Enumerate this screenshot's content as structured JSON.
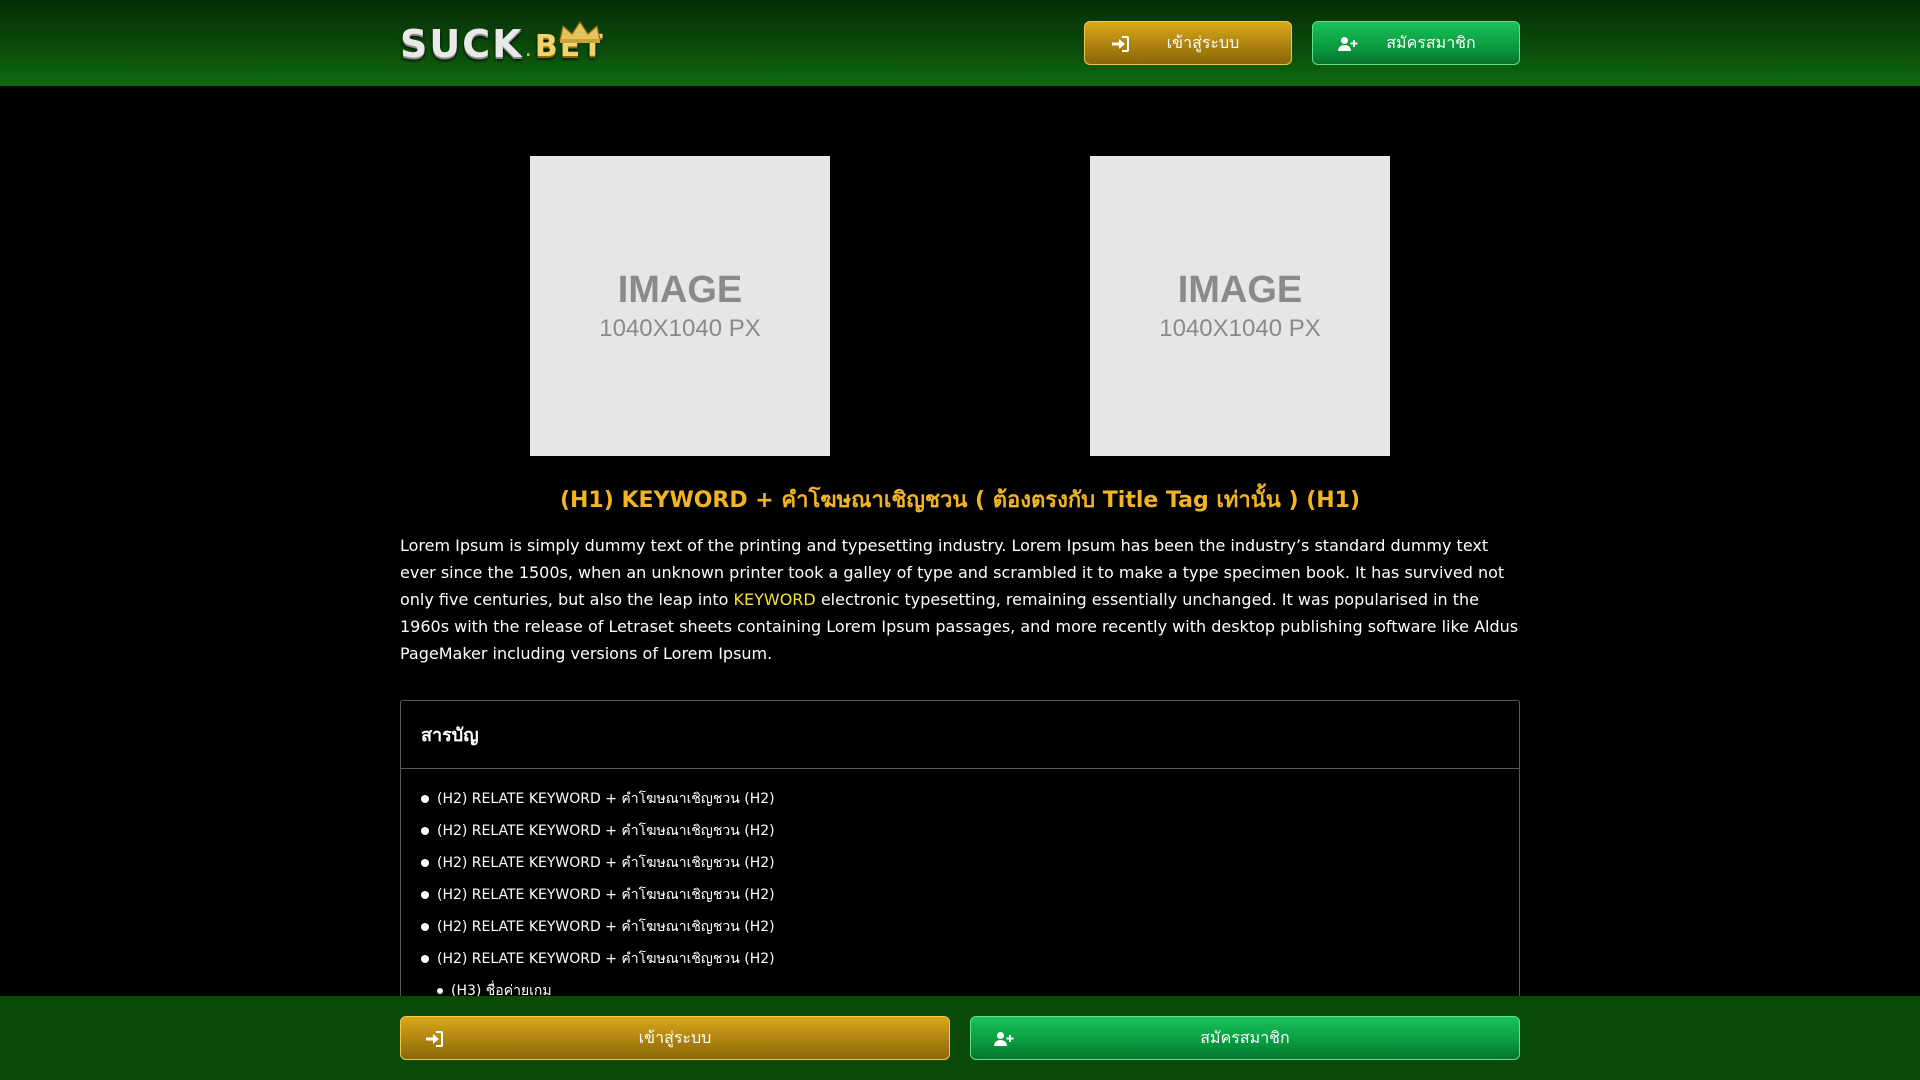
{
  "header": {
    "logo_main": "SUCK",
    "logo_dot": ".",
    "logo_bet": "BET",
    "login_label": "เข้าสู่ระบบ",
    "register_label": "สมัครสมาชิก",
    "login_icon": "sign-in-icon",
    "register_icon": "user-plus-icon"
  },
  "images": [
    {
      "title": "IMAGE",
      "subtitle": "1040X1040 PX"
    },
    {
      "title": "IMAGE",
      "subtitle": "1040X1040 PX"
    }
  ],
  "content": {
    "h1": "(H1) KEYWORD + คำโฆษณาเชิญชวน ( ต้องตรงกับ Title Tag เท่านั้น ) (H1)",
    "para_part1": "Lorem Ipsum is simply dummy text of the printing and typesetting industry. Lorem Ipsum has been the industry’s standard dummy text ever since the 1500s, when an unknown printer took a galley of type and scrambled it to make a type specimen book. It has survived not only five centuries, but also the leap into ",
    "para_keyword": "KEYWORD",
    "para_part2": " electronic typesetting, remaining essentially unchanged. It was popularised in the 1960s with the release of Letraset sheets containing Lorem Ipsum passages, and more recently with desktop publishing software like Aldus PageMaker including versions of Lorem Ipsum."
  },
  "toc": {
    "title": "สารบัญ",
    "items": [
      {
        "label": "(H2) RELATE KEYWORD + คำโฆษณาเชิญชวน (H2)"
      },
      {
        "label": "(H2) RELATE KEYWORD + คำโฆษณาเชิญชวน (H2)"
      },
      {
        "label": "(H2) RELATE KEYWORD + คำโฆษณาเชิญชวน (H2)"
      },
      {
        "label": "(H2) RELATE KEYWORD + คำโฆษณาเชิญชวน (H2)"
      },
      {
        "label": "(H2) RELATE KEYWORD + คำโฆษณาเชิญชวน (H2)"
      },
      {
        "label": "(H2) RELATE KEYWORD + คำโฆษณาเชิญชวน (H2)"
      },
      {
        "label": "(H3) ชื่อค่ายเกม"
      }
    ]
  },
  "footer": {
    "login_label": "เข้าสู่ระบบ",
    "register_label": "สมัครสมาชิก"
  },
  "colors": {
    "gold_button": "#c9990f",
    "green_button": "#0fae4a",
    "heading": "#f2b422",
    "keyword": "#f6e13a",
    "header_bg": "#0b4a0b",
    "footer_bg": "#0a4a08"
  }
}
